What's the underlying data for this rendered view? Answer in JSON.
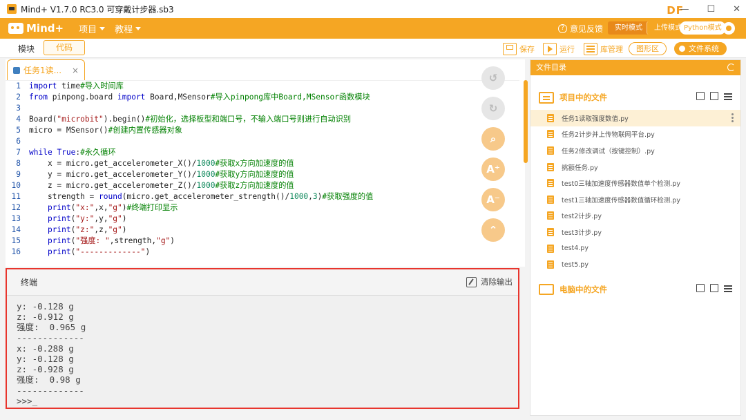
{
  "titlebar": {
    "title": "Mind+ V1.7.0 RC3.0    可穿戴计步器.sb3",
    "minimize": "—",
    "maximize": "☐",
    "close": "✕",
    "brand": "DF"
  },
  "menubar": {
    "logo": "Mind+",
    "items": [
      "项目",
      "教程"
    ],
    "feedback": "意见反馈",
    "modes": {
      "live": "实时模式",
      "upload": "上传模式",
      "python": "Python模式"
    }
  },
  "toolbar": {
    "tab_block": "模块",
    "tab_code": "代码",
    "save": "保存",
    "run": "运行",
    "library": "库管理",
    "graph": "图形区",
    "system": "文件系统"
  },
  "editor": {
    "file_tab": "任务1读...",
    "close": "×",
    "fab_icons": [
      "undo-icon",
      "redo-icon",
      "search-icon",
      "font-increase-icon",
      "font-decrease-icon",
      "collapse-top-icon"
    ],
    "fab_labels": [
      "↺",
      "↻",
      "⌕",
      "A⁺",
      "A⁻",
      "⌃"
    ],
    "lines": [
      {
        "n": "1",
        "parts": [
          [
            "kw",
            "import"
          ],
          [
            "fn",
            " time"
          ],
          [
            "cm",
            "#导入时间库"
          ]
        ]
      },
      {
        "n": "2",
        "parts": [
          [
            "kw",
            "from"
          ],
          [
            "fn",
            " pinpong.board "
          ],
          [
            "kw",
            "import"
          ],
          [
            "fn",
            " Board,MSensor"
          ],
          [
            "cm",
            "#导入pinpong库中Board,MSensor函数模块"
          ]
        ]
      },
      {
        "n": "3",
        "parts": []
      },
      {
        "n": "4",
        "parts": [
          [
            "fn",
            "Board("
          ],
          [
            "st",
            "\"microbit\""
          ],
          [
            "fn",
            ").begin()"
          ],
          [
            "cm",
            "#初始化，选择板型和端口号，不输入端口号则进行自动识别"
          ]
        ]
      },
      {
        "n": "5",
        "parts": [
          [
            "fn",
            "micro = MSensor()"
          ],
          [
            "cm",
            "#创建内置传感器对象"
          ]
        ]
      },
      {
        "n": "6",
        "parts": []
      },
      {
        "n": "7",
        "parts": [
          [
            "kw",
            "while"
          ],
          [
            "fn",
            " "
          ],
          [
            "kw",
            "True"
          ],
          [
            "fn",
            ":"
          ],
          [
            "cm",
            "#永久循环"
          ]
        ]
      },
      {
        "n": "8",
        "parts": [
          [
            "fn",
            "    x = micro.get_accelerometer_X()/"
          ],
          [
            "nm",
            "1000"
          ],
          [
            "cm",
            "#获取x方向加速度的值"
          ]
        ]
      },
      {
        "n": "9",
        "parts": [
          [
            "fn",
            "    y = micro.get_accelerometer_Y()/"
          ],
          [
            "nm",
            "1000"
          ],
          [
            "cm",
            "#获取y方向加速度的值"
          ]
        ]
      },
      {
        "n": "10",
        "parts": [
          [
            "fn",
            "    z = micro.get_accelerometer_Z()/"
          ],
          [
            "nm",
            "1000"
          ],
          [
            "cm",
            "#获取z方向加速度的值"
          ]
        ]
      },
      {
        "n": "11",
        "parts": [
          [
            "fn",
            "    strength = "
          ],
          [
            "kw",
            "round"
          ],
          [
            "fn",
            "(micro.get_accelerometer_strength()/"
          ],
          [
            "nm",
            "1000"
          ],
          [
            "fn",
            ","
          ],
          [
            "nm",
            "3"
          ],
          [
            "fn",
            ")"
          ],
          [
            "cm",
            "#获取强度的值"
          ]
        ]
      },
      {
        "n": "12",
        "parts": [
          [
            "fn",
            "    "
          ],
          [
            "kw",
            "print"
          ],
          [
            "fn",
            "("
          ],
          [
            "st",
            "\"x:\""
          ],
          [
            "fn",
            ",x,"
          ],
          [
            "st",
            "\"g\""
          ],
          [
            "fn",
            ")"
          ],
          [
            "cm",
            "#终端打印显示"
          ]
        ]
      },
      {
        "n": "13",
        "parts": [
          [
            "fn",
            "    "
          ],
          [
            "kw",
            "print"
          ],
          [
            "fn",
            "("
          ],
          [
            "st",
            "\"y:\""
          ],
          [
            "fn",
            ",y,"
          ],
          [
            "st",
            "\"g\""
          ],
          [
            "fn",
            ")"
          ]
        ]
      },
      {
        "n": "14",
        "parts": [
          [
            "fn",
            "    "
          ],
          [
            "kw",
            "print"
          ],
          [
            "fn",
            "("
          ],
          [
            "st",
            "\"z:\""
          ],
          [
            "fn",
            ",z,"
          ],
          [
            "st",
            "\"g\""
          ],
          [
            "fn",
            ")"
          ]
        ]
      },
      {
        "n": "15",
        "parts": [
          [
            "fn",
            "    "
          ],
          [
            "kw",
            "print"
          ],
          [
            "fn",
            "("
          ],
          [
            "st",
            "\"强度: \""
          ],
          [
            "fn",
            ",strength,"
          ],
          [
            "st",
            "\"g\""
          ],
          [
            "fn",
            ")"
          ]
        ]
      },
      {
        "n": "16",
        "parts": [
          [
            "fn",
            "    "
          ],
          [
            "kw",
            "print"
          ],
          [
            "fn",
            "("
          ],
          [
            "st",
            "\"-------------\""
          ],
          [
            "fn",
            ")"
          ]
        ]
      }
    ]
  },
  "terminal": {
    "title": "终端",
    "clear": "清除输出",
    "output": [
      "y: -0.128 g",
      "z: -0.912 g",
      "强度:  0.965 g",
      "-------------",
      "x: -0.288 g",
      "y: -0.128 g",
      "z: -0.928 g",
      "强度:  0.98 g",
      "-------------",
      ">>>_"
    ]
  },
  "files_panel": {
    "title": "文件目录",
    "project_section": "项目中的文件",
    "pc_section": "电脑中的文件",
    "project_files": [
      "任务1读取强度数值.py",
      "任务2计步并上传物联网平台.py",
      "任务2修改调试（按键控制）.py",
      "挑额任务.py",
      "test0三轴加速度传感器数值单个检测.py",
      "test1三轴加速度传感器数值循环检测.py",
      "test2计步.py",
      "test3计步.py",
      "test4.py",
      "test5.py"
    ],
    "selected_index": 0
  }
}
